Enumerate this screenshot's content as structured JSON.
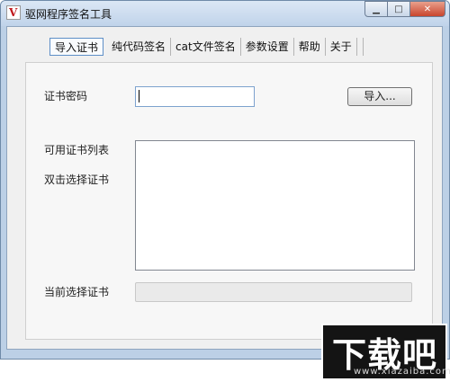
{
  "window": {
    "title": "驱网程序签名工具"
  },
  "app_icon": {
    "glyph": "V",
    "icon": "signing-app-icon"
  },
  "controls": {
    "minimize": "▁",
    "maximize": "□",
    "close": "✕"
  },
  "tabs": [
    {
      "label": "导入证书",
      "active": true
    },
    {
      "label": "纯代码签名",
      "active": false
    },
    {
      "label": "cat文件签名",
      "active": false
    },
    {
      "label": "参数设置",
      "active": false
    },
    {
      "label": "帮助",
      "active": false
    },
    {
      "label": "关于",
      "active": false
    }
  ],
  "form": {
    "password_label": "证书密码",
    "password_value": "",
    "import_button": "导入...",
    "cert_list_label": "可用证书列表",
    "cert_list_hint": "双击选择证书",
    "current_label": "当前选择证书",
    "current_value": ""
  },
  "watermark": {
    "text": "下载吧",
    "url": "www.xiazaiba.com"
  }
}
